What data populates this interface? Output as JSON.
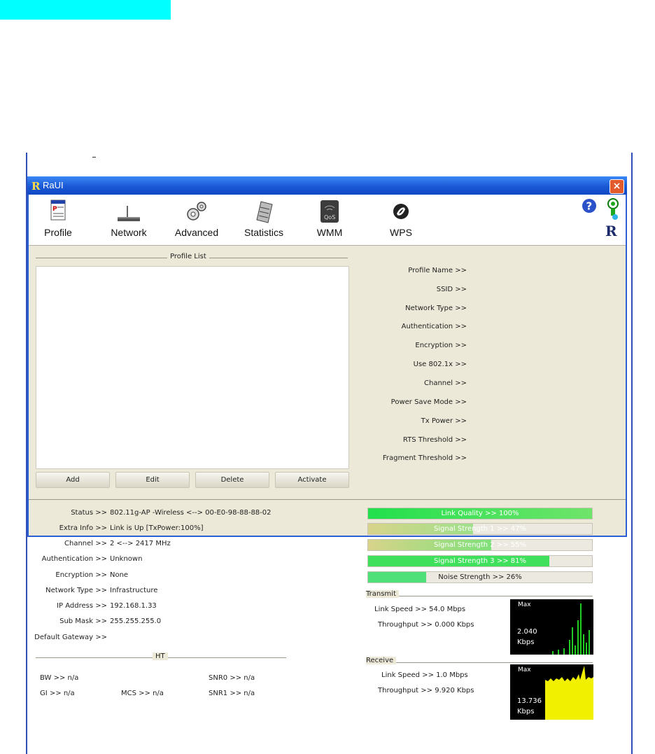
{
  "window": {
    "title": "RaUI",
    "close_label": "×"
  },
  "toolbar": {
    "items": [
      {
        "label": "Profile",
        "icon": "profile-icon"
      },
      {
        "label": "Network",
        "icon": "network-icon"
      },
      {
        "label": "Advanced",
        "icon": "advanced-icon"
      },
      {
        "label": "Statistics",
        "icon": "statistics-icon"
      },
      {
        "label": "WMM",
        "icon": "wmm-icon",
        "icon_text": "QoS"
      },
      {
        "label": "WPS",
        "icon": "wps-icon"
      }
    ],
    "help_icon": "help-icon",
    "signal_icon": "signal-icon"
  },
  "profile": {
    "list_title": "Profile List",
    "buttons": {
      "add": "Add",
      "edit": "Edit",
      "delete": "Delete",
      "activate": "Activate"
    },
    "fields": [
      "Profile Name >>",
      "SSID >>",
      "Network Type >>",
      "Authentication >>",
      "Encryption >>",
      "Use 802.1x >>",
      "Channel >>",
      "Power Save Mode >>",
      "Tx Power >>",
      "RTS Threshold >>",
      "Fragment Threshold >>"
    ]
  },
  "status": {
    "rows": [
      {
        "label": "Status >>",
        "value": "802.11g-AP -Wireless <--> 00-E0-98-88-88-02"
      },
      {
        "label": "Extra Info >>",
        "value": "Link is Up [TxPower:100%]"
      },
      {
        "label": "Channel >>",
        "value": "2 <--> 2417 MHz"
      },
      {
        "label": "Authentication >>",
        "value": "Unknown"
      },
      {
        "label": "Encryption >>",
        "value": "None"
      },
      {
        "label": "Network Type >>",
        "value": "Infrastructure"
      },
      {
        "label": "IP Address >>",
        "value": "192.168.1.33"
      },
      {
        "label": "Sub Mask >>",
        "value": "255.255.255.0"
      },
      {
        "label": "Default Gateway >>",
        "value": ""
      }
    ],
    "ht": {
      "title": "HT",
      "bw": "BW >> n/a",
      "gi": "GI >> n/a",
      "mcs": "MCS >> n/a",
      "snr0": "SNR0 >> n/a",
      "snr1": "SNR1 >> n/a"
    }
  },
  "signal": {
    "bars": [
      {
        "label": "Link Quality >> 100%",
        "level": 1.0,
        "color": "#22e04c",
        "color2": "#6fe46a"
      },
      {
        "label": "Signal Strength 1 >> 47%",
        "level": 0.47,
        "color": "#d8d48a",
        "color2": "#9fe08a"
      },
      {
        "label": "Signal Strength 2 >> 55%",
        "level": 0.55,
        "color": "#d8d48a",
        "color2": "#7fe07a"
      },
      {
        "label": "Signal Strength 3 >> 81%",
        "level": 0.81,
        "color": "#3fe05c",
        "color2": "#3fe05c"
      },
      {
        "label": "Noise Strength >> 26%",
        "level": 0.26,
        "color": "#4fe07a",
        "color2": "#4fe07a"
      }
    ]
  },
  "transmit": {
    "title": "Transmit",
    "link_speed": "Link Speed >> 54.0 Mbps",
    "throughput": "Throughput >> 0.000 Kbps",
    "graph_max": "Max",
    "graph_value": "2.040",
    "graph_unit": "Kbps",
    "graph_color": "#22cc22"
  },
  "receive": {
    "title": "Receive",
    "link_speed": "Link Speed >> 1.0 Mbps",
    "throughput": "Throughput >> 9.920 Kbps",
    "graph_max": "Max",
    "graph_value": "13.736",
    "graph_unit": "Kbps",
    "graph_color": "#f0f000"
  }
}
